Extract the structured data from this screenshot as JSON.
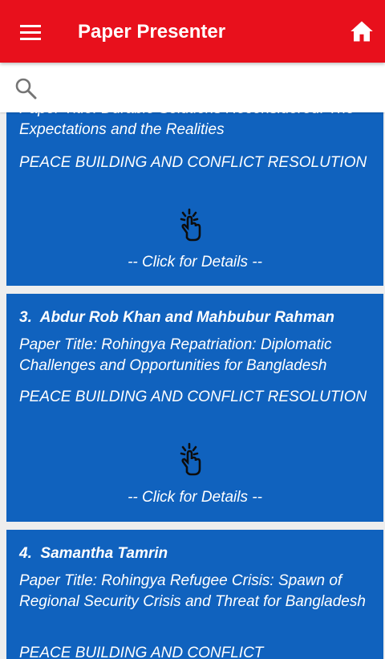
{
  "app_bar": {
    "title": "Paper Presenter",
    "menu_icon": "hamburger-menu-icon",
    "home_icon": "home-icon",
    "background_color": "#e8101c"
  },
  "search": {
    "placeholder": "",
    "value": "",
    "icon": "search-icon"
  },
  "card_color": "#1062be",
  "cards": [
    {
      "number": "",
      "presenter": "",
      "paper_title": "Paper Title: Durable Solutions Reconsidered: The Expectations and the Realities",
      "topic": "PEACE BUILDING AND CONFLICT RESOLUTION",
      "details": "-- Click for Details --",
      "icon": "tap-hand-icon"
    },
    {
      "number": "3.",
      "presenter": "Abdur Rob Khan and Mahbubur Rahman",
      "paper_title": "Paper Title: Rohingya Repatriation: Diplomatic Challenges and Opportunities for Bangladesh",
      "topic": "PEACE BUILDING AND CONFLICT RESOLUTION",
      "details": "-- Click for Details --",
      "icon": "tap-hand-icon"
    },
    {
      "number": "4.",
      "presenter": "Samantha Tamrin",
      "paper_title": "Paper Title: Rohingya Refugee Crisis: Spawn of Regional Security Crisis and Threat for Bangladesh",
      "topic": "PEACE BUILDING AND CONFLICT",
      "details": "",
      "icon": ""
    }
  ]
}
